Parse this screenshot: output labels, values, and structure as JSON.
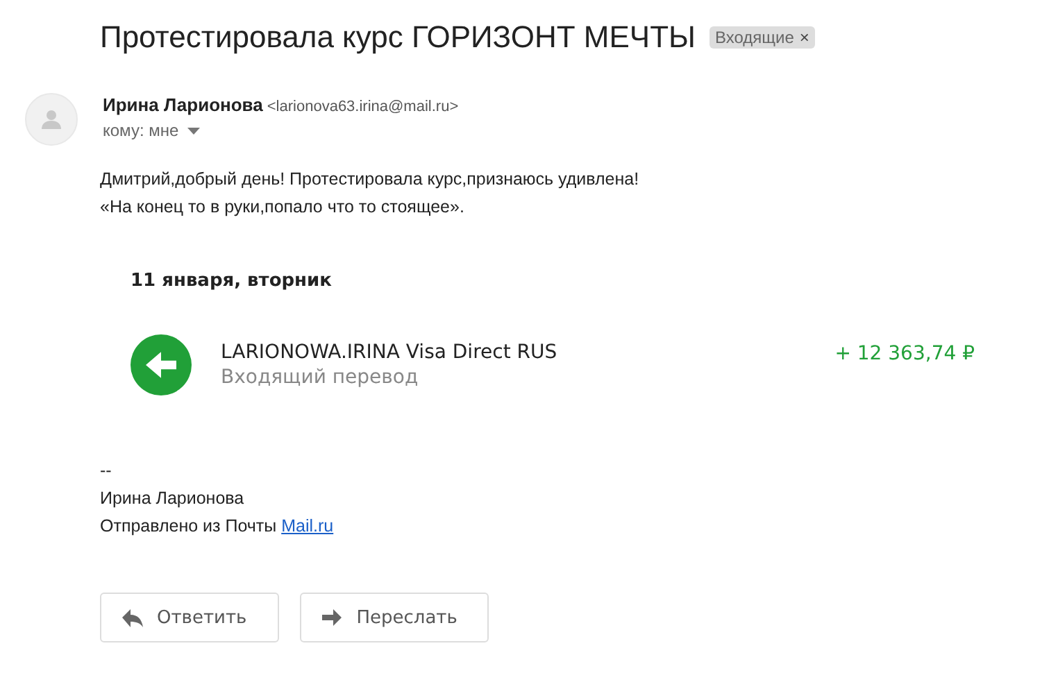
{
  "subject": "Протестировала курс ГОРИЗОНТ МЕЧТЫ",
  "labels": [
    {
      "text": "Входящие",
      "close": "×"
    }
  ],
  "sender": {
    "name": "Ирина Ларионова",
    "email": "<larionova63.irina@mail.ru>",
    "to": "кому: мне"
  },
  "body": [
    "Дмитрий,добрый день! Протестировала курс,признаюсь удивлена!",
    "«На конец то в руки,попало что то стоящее»."
  ],
  "receipt": {
    "date": "11 января, вторник",
    "transactions": [
      {
        "kind": "incoming",
        "title": "LARIONOWA.IRINA Visa Direct RUS",
        "subtitle": "Входящий перевод",
        "amount": "+ 12 363,74 ₽"
      }
    ]
  },
  "signature": {
    "separator": "--",
    "name": "Ирина Ларионова",
    "sent_from": "Отправлено из Почты",
    "link": "Mail.ru"
  },
  "buttons": [
    {
      "kind": "reply",
      "label": "Ответить"
    },
    {
      "kind": "forward",
      "label": "Переслать"
    }
  ]
}
